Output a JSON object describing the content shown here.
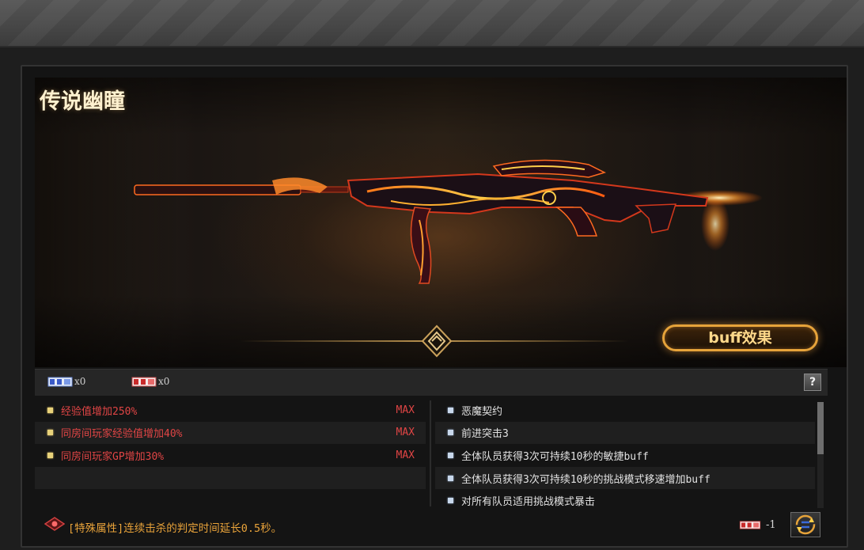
{
  "weapon": {
    "title": "传说幽瞳"
  },
  "buff_button": {
    "label": "buff效果"
  },
  "slots": [
    {
      "count": "x0"
    },
    {
      "count": "x0"
    }
  ],
  "help": {
    "label": "?"
  },
  "attributes": {
    "left": [
      {
        "text": "经验值增加250%",
        "level": "MAX"
      },
      {
        "text": "同房间玩家经验值增加40%",
        "level": "MAX"
      },
      {
        "text": "同房间玩家GP增加30%",
        "level": "MAX"
      }
    ],
    "right": [
      {
        "text": "恶魔契约"
      },
      {
        "text": "前进突击3"
      },
      {
        "text": "全体队员获得3次可持续10秒的敏捷buff"
      },
      {
        "text": "全体队员获得3次可持续10秒的挑战模式移速增加buff"
      },
      {
        "text": "对所有队员适用挑战模式暴击"
      }
    ]
  },
  "special": {
    "text": "[特殊属性]连续击杀的判定时间延长0.5秒。"
  },
  "cost": {
    "text": "-1"
  },
  "colors": {
    "accent": "#e6a33a",
    "attr_red": "#e04545",
    "special_orange": "#e9a33a"
  }
}
